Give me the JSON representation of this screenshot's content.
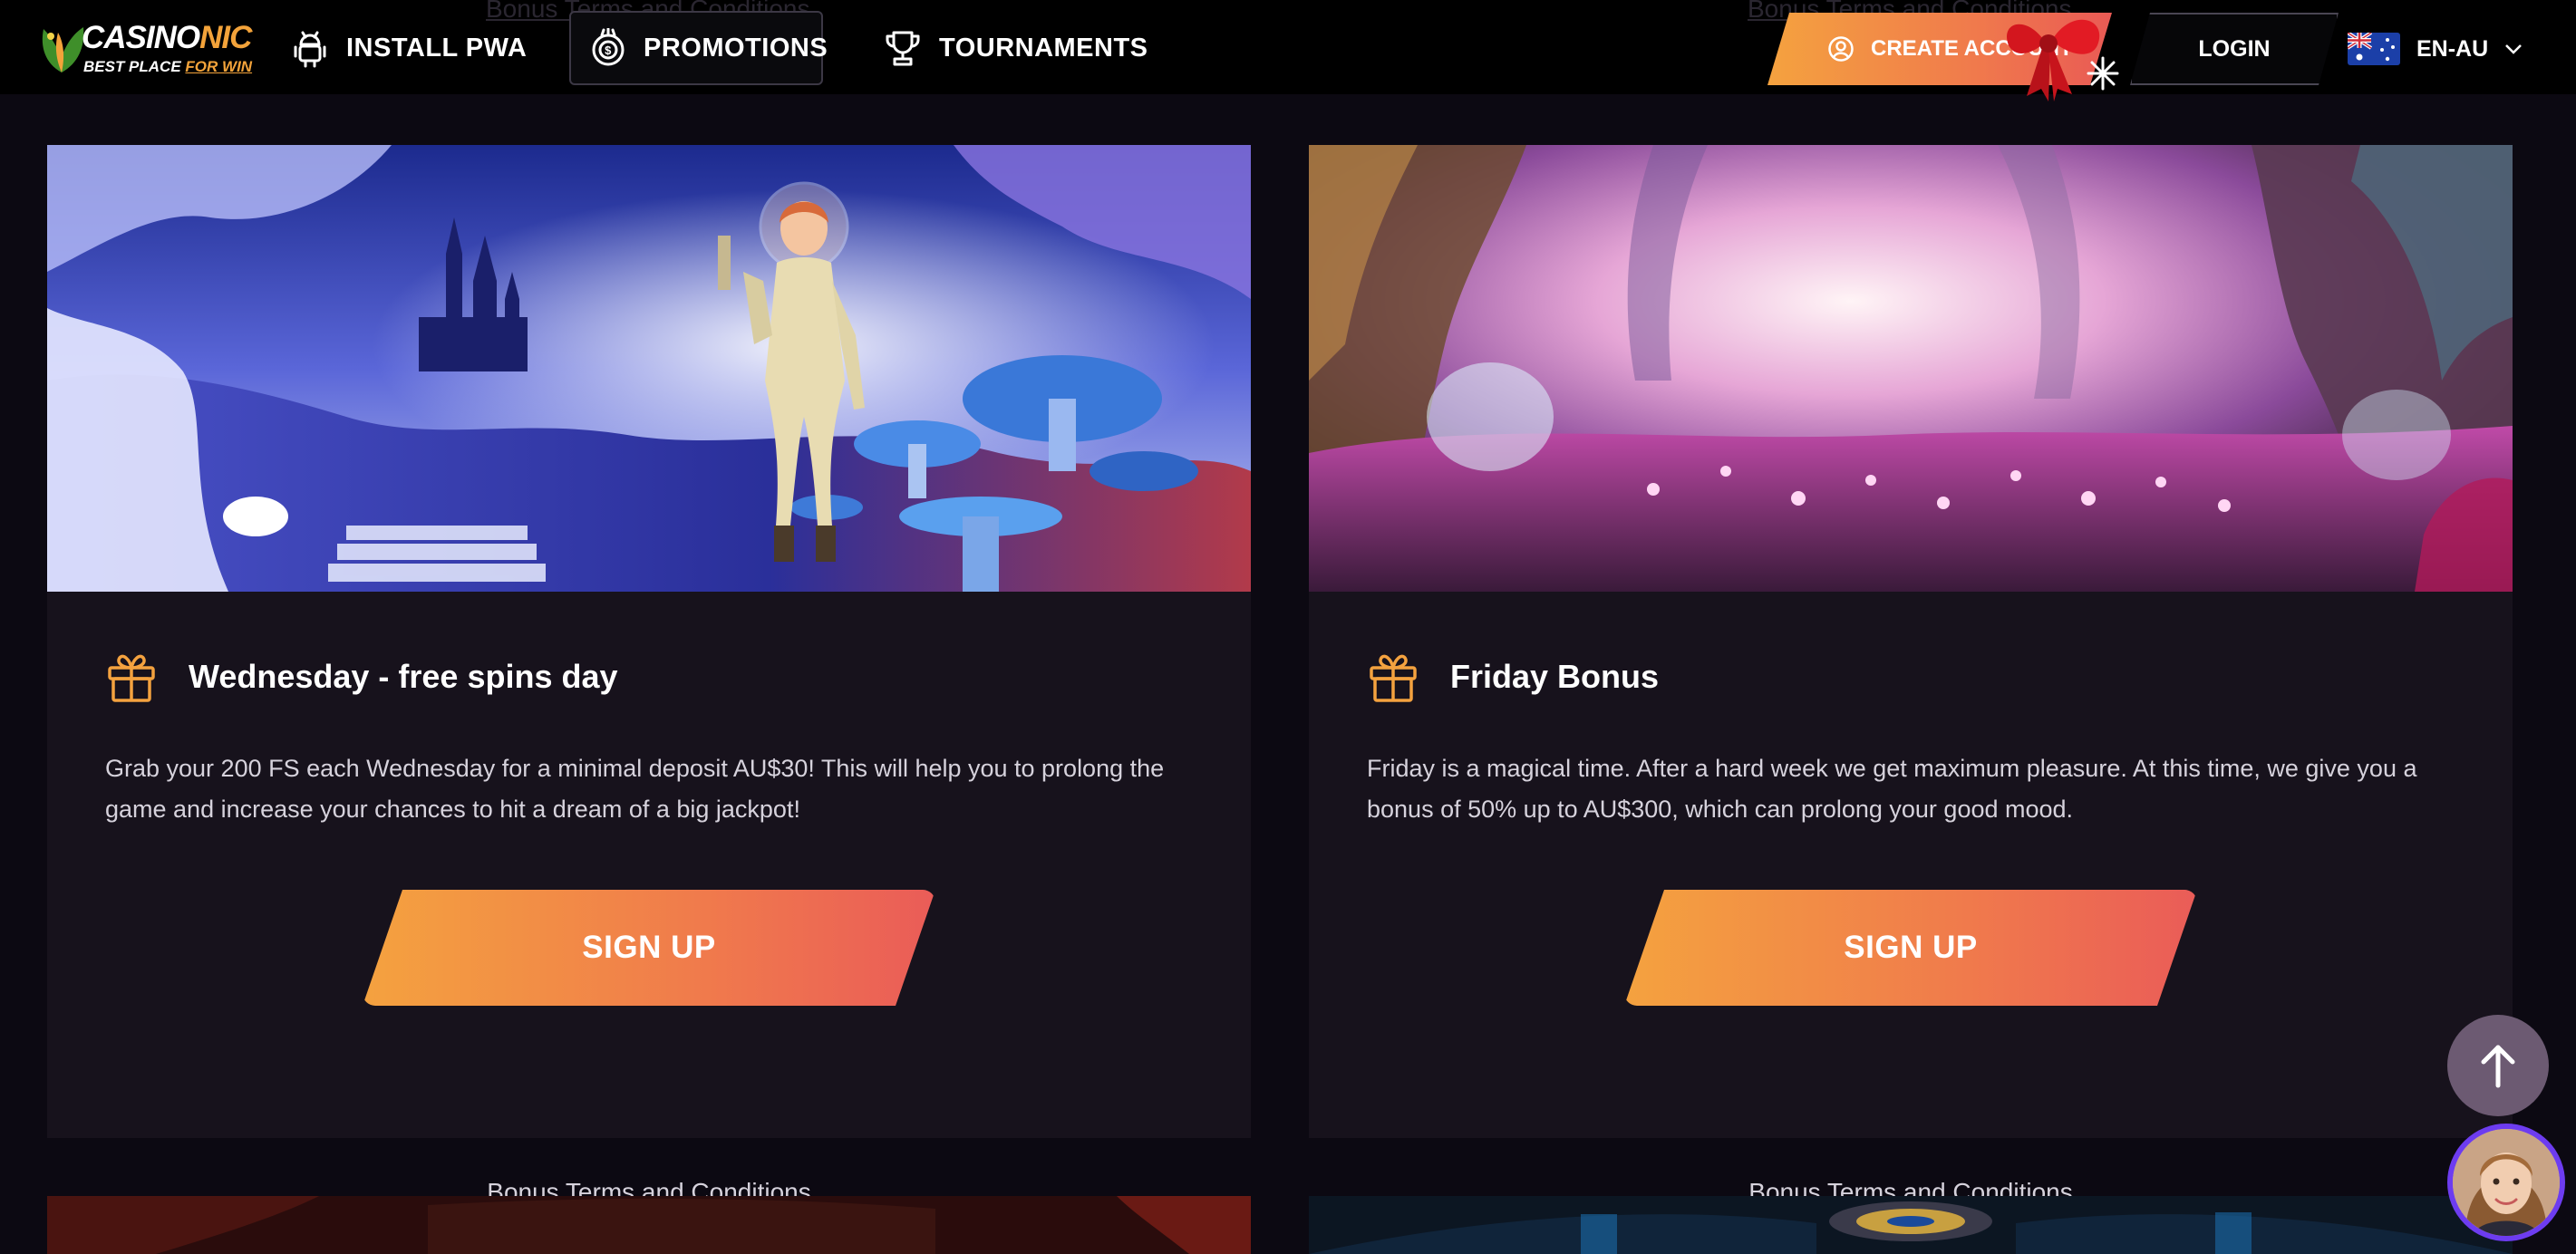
{
  "header": {
    "logo": {
      "brand_main": "CASINO",
      "brand_accent": "NIC",
      "tagline_start": "BEST PLACE",
      "tagline_accent": "FOR WIN"
    },
    "nav": [
      {
        "label": "INSTALL PWA",
        "icon": "android-icon"
      },
      {
        "label": "PROMOTIONS",
        "icon": "coin-icon"
      },
      {
        "label": "TOURNAMENTS",
        "icon": "trophy-icon"
      }
    ],
    "create_account_label": "CREATE ACCOUNT",
    "login_label": "LOGIN",
    "language": {
      "label": "EN-AU",
      "flag": "australia-flag-icon"
    },
    "ghost_terms": "Bonus Terms and Conditions"
  },
  "promotions": [
    {
      "title": "Wednesday - free spins day",
      "description": "Grab your 200 FS each Wednesday for a minimal deposit AU$30! This will help you to prolong the game and increase your chances to hit a dream of a big jackpot!",
      "button": "SIGN UP",
      "terms": "Bonus Terms and Conditions",
      "icon": "gift-icon"
    },
    {
      "title": "Friday Bonus",
      "description": "Friday is a magical time. After a hard week we get maximum pleasure. At this time, we give you a bonus of 50% up to AU$300, which can prolong your good mood.",
      "button": "SIGN UP",
      "terms": "Bonus Terms and Conditions",
      "icon": "gift-icon"
    }
  ],
  "colors": {
    "background": "#0c0912",
    "card": "#17121c",
    "accent_start": "#f4a23f",
    "accent_end": "#ea5c58",
    "scroll_top_button": "#6c5a72",
    "avatar_ring": "#6d3cf0"
  },
  "floating": {
    "scroll_top_icon": "arrow-up-icon",
    "chat_icon": "support-avatar"
  }
}
